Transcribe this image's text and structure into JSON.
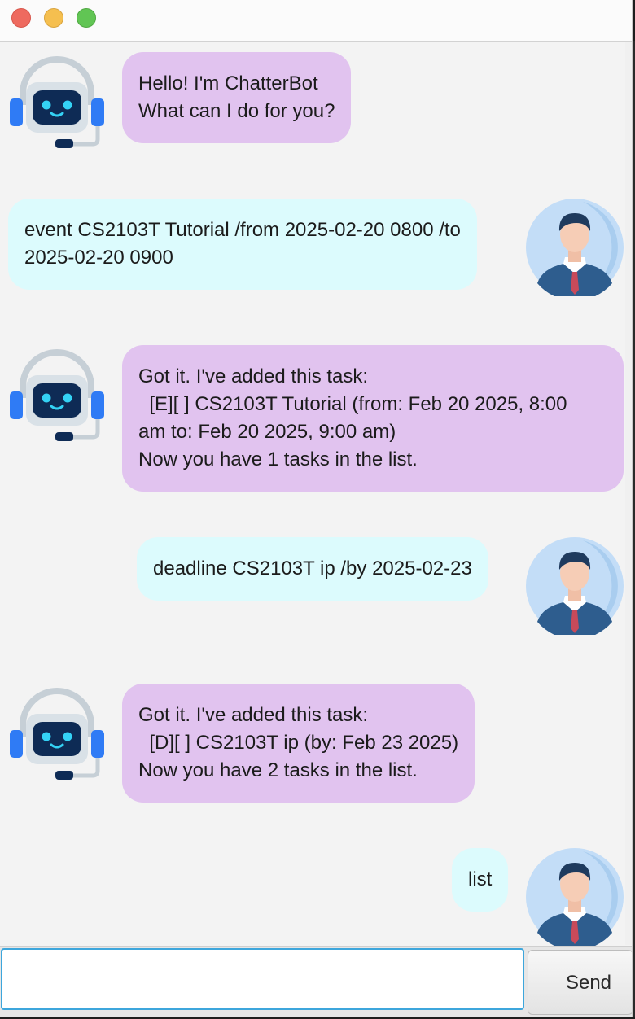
{
  "window": {
    "controls": [
      "close",
      "minimize",
      "maximize"
    ]
  },
  "messages": [
    {
      "sender": "bot",
      "text": "Hello! I'm ChatterBot\nWhat can I do for you?"
    },
    {
      "sender": "user",
      "text": "event CS2103T Tutorial /from 2025-02-20 0800 /to\n2025-02-20 0900"
    },
    {
      "sender": "bot",
      "text": "Got it. I've added this task:\n  [E][ ] CS2103T Tutorial (from: Feb 20 2025, 8:00\nam to: Feb 20 2025, 9:00 am)\nNow you have 1 tasks in the list."
    },
    {
      "sender": "user",
      "text": "deadline CS2103T ip /by 2025-02-23"
    },
    {
      "sender": "bot",
      "text": "Got it. I've added this task:\n  [D][ ] CS2103T ip (by: Feb 23 2025)\nNow you have 2 tasks in the list."
    },
    {
      "sender": "user",
      "text": "list"
    }
  ],
  "input": {
    "value": "",
    "placeholder": ""
  },
  "send_label": "Send",
  "colors": {
    "bot_bubble": "#e1c3ef",
    "user_bubble": "#dcfbfd",
    "background": "#f3f3f3",
    "input_focus": "#3da6dc"
  }
}
